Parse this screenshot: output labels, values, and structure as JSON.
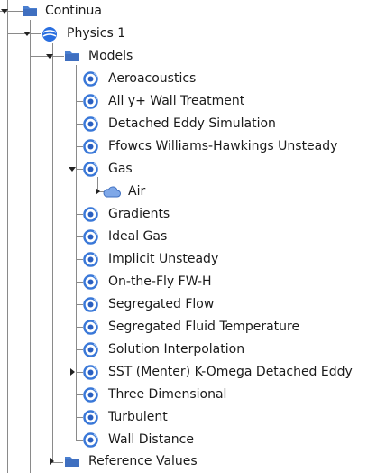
{
  "tree": {
    "continua": {
      "label": "Continua",
      "icon": "folder-icon"
    },
    "physics": {
      "label": "Physics 1",
      "icon": "physics-continuum-icon"
    },
    "models": {
      "label": "Models",
      "icon": "folder-icon",
      "items": [
        {
          "label": "Aeroacoustics",
          "icon": "model-icon"
        },
        {
          "label": "All y+ Wall Treatment",
          "icon": "model-icon"
        },
        {
          "label": "Detached Eddy Simulation",
          "icon": "model-icon"
        },
        {
          "label": "Ffowcs Williams-Hawkings Unsteady",
          "icon": "model-icon"
        },
        {
          "label": "Gas",
          "icon": "model-icon",
          "expanded": true
        },
        {
          "label": "Air",
          "icon": "cloud-icon",
          "collapsed": true
        },
        {
          "label": "Gradients",
          "icon": "model-icon"
        },
        {
          "label": "Ideal Gas",
          "icon": "model-icon"
        },
        {
          "label": "Implicit Unsteady",
          "icon": "model-icon"
        },
        {
          "label": "On-the-Fly FW-H",
          "icon": "model-icon"
        },
        {
          "label": "Segregated Flow",
          "icon": "model-icon"
        },
        {
          "label": "Segregated Fluid Temperature",
          "icon": "model-icon"
        },
        {
          "label": "Solution Interpolation",
          "icon": "model-icon"
        },
        {
          "label": "SST (Menter) K-Omega Detached Eddy",
          "icon": "model-icon",
          "collapsed": true
        },
        {
          "label": "Three Dimensional",
          "icon": "model-icon"
        },
        {
          "label": "Turbulent",
          "icon": "model-icon"
        },
        {
          "label": "Wall Distance",
          "icon": "model-icon"
        }
      ]
    },
    "reference_values": {
      "label": "Reference Values",
      "icon": "folder-icon"
    }
  },
  "colors": {
    "folder": "#4a7fd0",
    "physics": "#2a6fe0",
    "model_ring": "#3a78d8",
    "cloud": "#7fa8e8",
    "lines": "#8a8a8a"
  }
}
